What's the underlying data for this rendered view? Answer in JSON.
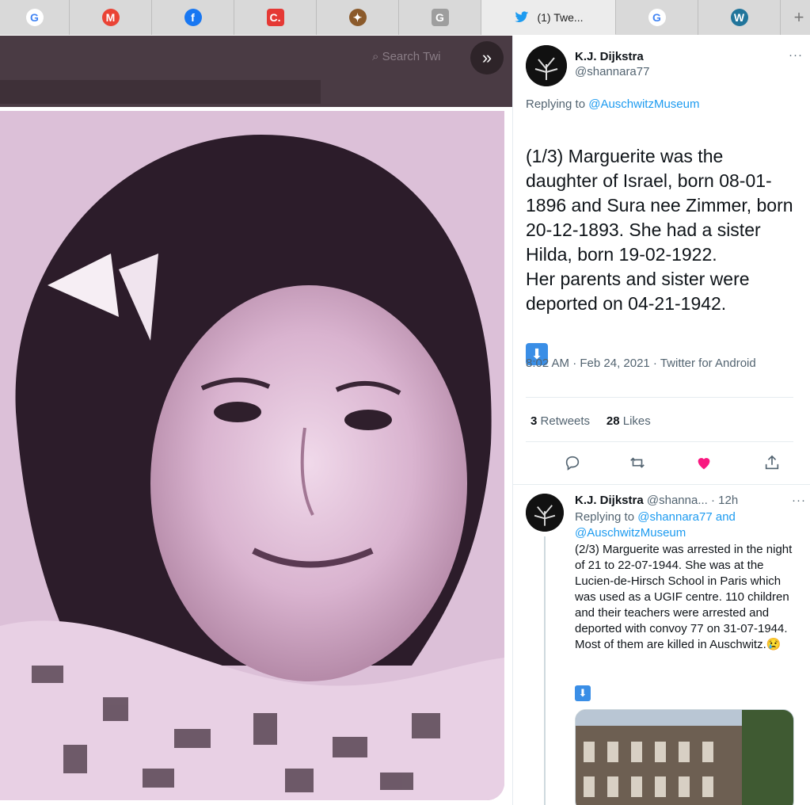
{
  "tabs": [
    {
      "icon": "google-icon",
      "glyph": "G",
      "color": "#4285F4",
      "width": 88
    },
    {
      "icon": "gmail-icon",
      "glyph": "M",
      "color": "#EA4335",
      "width": 104
    },
    {
      "icon": "facebook-icon",
      "glyph": "f",
      "color": "#1877F2",
      "width": 104
    },
    {
      "icon": "c-app-icon",
      "glyph": "C.",
      "color": "#e53935",
      "width": 104
    },
    {
      "icon": "crest-icon",
      "glyph": "✦",
      "color": "#8b5a2b",
      "width": 104
    },
    {
      "icon": "g-grey-icon",
      "glyph": "G",
      "color": "#9e9e9e",
      "width": 104
    },
    {
      "icon": "twitter-icon",
      "glyph": "",
      "color": "#1d9bf0",
      "width": 170,
      "label": "(1) Twe..."
    },
    {
      "icon": "google-icon",
      "glyph": "G",
      "color": "#4285F4",
      "width": 104
    },
    {
      "icon": "wordpress-icon",
      "glyph": "W",
      "color": "#21759b",
      "width": 104
    }
  ],
  "newtab": "+",
  "search": {
    "placeholder": "Search Twi"
  },
  "tweet": {
    "name": "K.J. Dijkstra",
    "handle": "@shannara77",
    "more": "···",
    "replying_prefix": "Replying to ",
    "replying_to": "@AuschwitzMuseum",
    "text": "(1/3) Marguerite was the daughter of Israel, born 08-01-1896 and Sura nee Zimmer, born 20-12-1893. She had a sister Hilda, born 19-02-1922.\nHer parents and sister were deported on 04-21-1942.",
    "arrow": "⬇",
    "meta": "8:02 AM · Feb 24, 2021 · Twitter for Android",
    "retweets_count": "3",
    "retweets_label": "Retweets",
    "likes_count": "28",
    "likes_label": "Likes"
  },
  "reply": {
    "name": "K.J. Dijkstra",
    "handle_time": "@shanna... · 12h",
    "more": "···",
    "replying_prefix": "Replying to ",
    "replying_links": "@shannara77 and @AuschwitzMuseum",
    "text": "(2/3) Marguerite was arrested in the night of 21 to 22-07-1944. She was at the Lucien-de-Hirsch School in Paris which was used as a UGIF centre. 110 children and their teachers were arrested and deported with convoy 77 on 31-07-1944. Most of them are killed in Auschwitz.😢",
    "arrow": "⬇"
  },
  "colors": {
    "heart": "#f91880",
    "accent": "#1d9bf0"
  }
}
